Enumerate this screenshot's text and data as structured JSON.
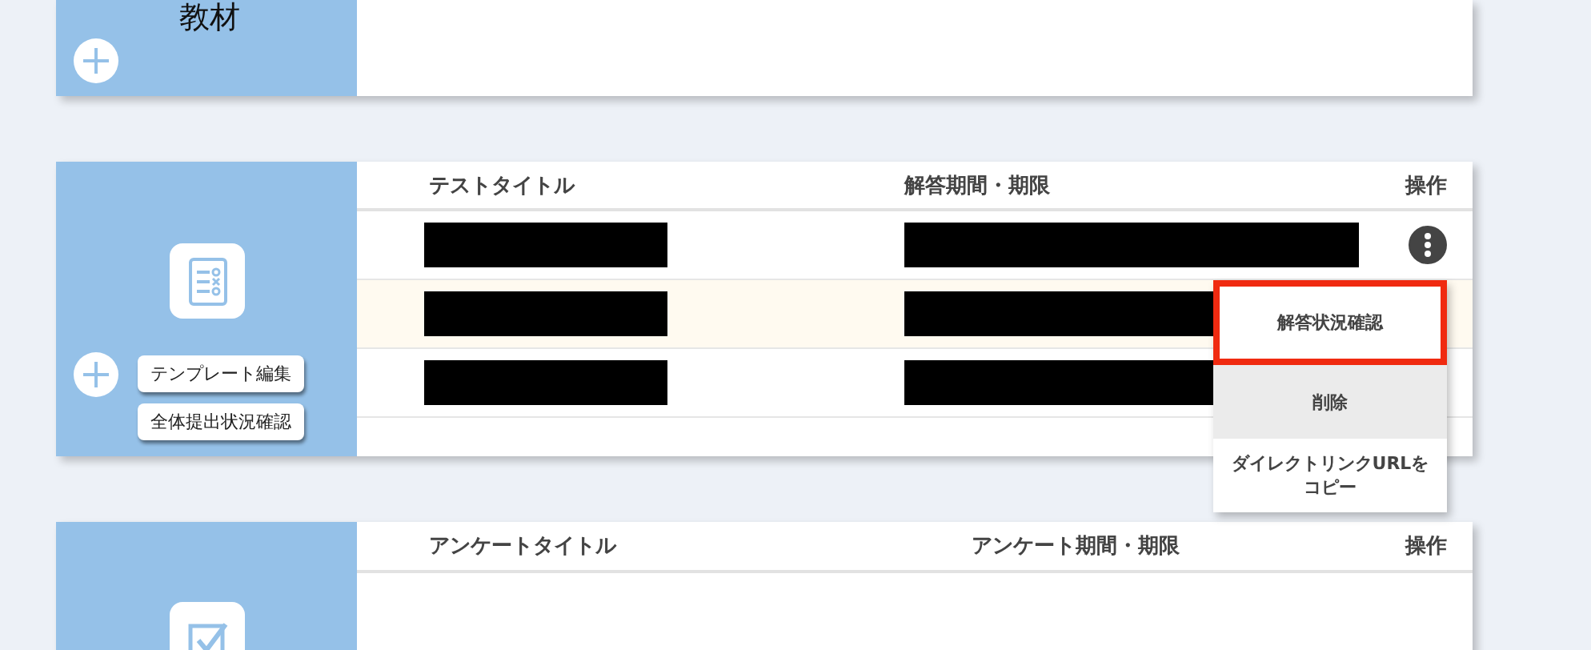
{
  "materials_card": {
    "title": "教材"
  },
  "test_card": {
    "buttons": [
      "テンプレート編集",
      "全体提出状況確認"
    ],
    "columns": [
      "テストタイトル",
      "解答期間・期限",
      "操作"
    ],
    "rows": [
      {
        "highlighted": false,
        "has_menu_button": true
      },
      {
        "highlighted": true,
        "has_menu_button": false
      },
      {
        "highlighted": false,
        "has_menu_button": false
      }
    ],
    "menu": [
      {
        "label": "解答状況確認",
        "outlined": true,
        "hovered": false
      },
      {
        "label": "削除",
        "outlined": false,
        "hovered": true
      },
      {
        "label": "ダイレクトリンクURLをコピー",
        "outlined": false,
        "hovered": false
      }
    ]
  },
  "survey_card": {
    "columns": [
      "アンケートタイトル",
      "アンケート期間・期限",
      "操作"
    ]
  }
}
